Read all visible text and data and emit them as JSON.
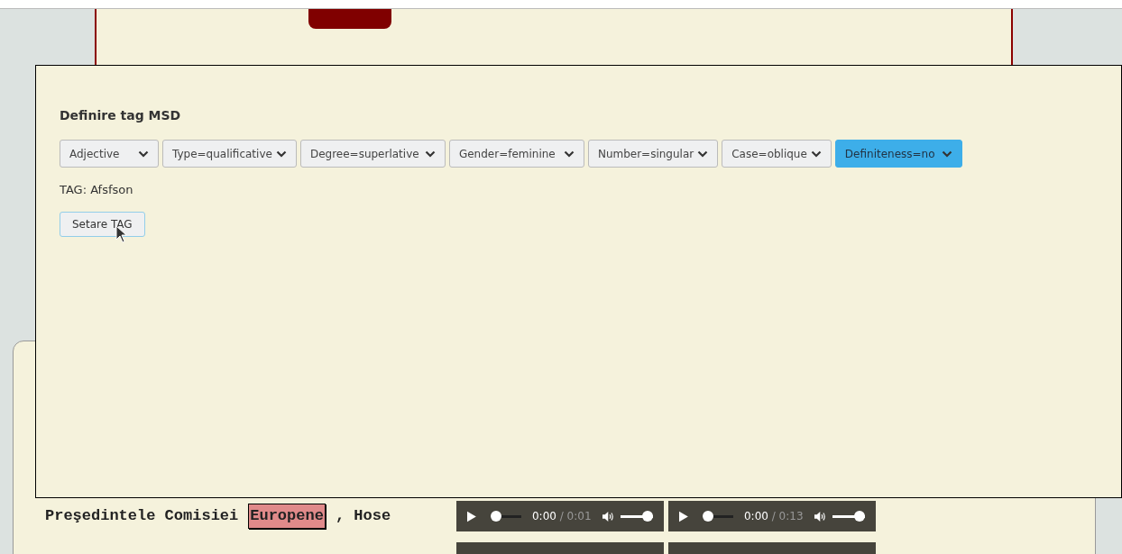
{
  "dialog": {
    "title": "Definire tag MSD",
    "selects": [
      {
        "label": "Adjective",
        "highlighted": false
      },
      {
        "label": "Type=qualificative",
        "highlighted": false
      },
      {
        "label": "Degree=superlative",
        "highlighted": false
      },
      {
        "label": "Gender=feminine",
        "highlighted": false
      },
      {
        "label": "Number=singular",
        "highlighted": false
      },
      {
        "label": "Case=oblique",
        "highlighted": false
      },
      {
        "label": "Definiteness=no",
        "highlighted": true
      }
    ],
    "tag": "TAG: Afsfson",
    "button": "Setare TAG"
  },
  "sentence": {
    "words": [
      {
        "text": "Preşedintele Comisiei",
        "highlighted": false
      },
      {
        "text": "Europene",
        "highlighted": true
      },
      {
        "text": ", Hose",
        "highlighted": false
      }
    ],
    "players": [
      {
        "current": "0:00",
        "duration": "/ 0:01",
        "volume": {
          "level": 1
        }
      },
      {
        "current": "0:00",
        "duration": "/ 0:13",
        "volume": {
          "level": 1
        }
      }
    ]
  }
}
